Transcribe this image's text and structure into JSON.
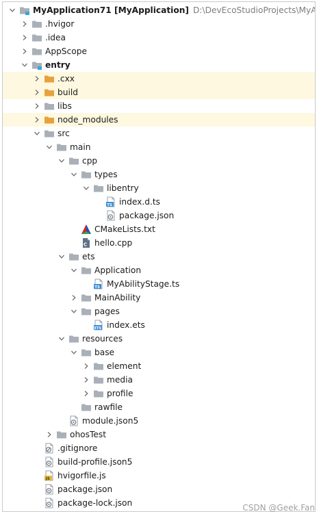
{
  "project": {
    "name": "MyApplication71",
    "module_tag": "[MyApplication]",
    "path": "D:\\DevEcoStudioProjects\\MyApp"
  },
  "tree": [
    {
      "label": "MyApplication71 [MyApplication]",
      "depth": 0,
      "arrow": "down",
      "icon": "module-folder",
      "bold": true,
      "path": "D:\\DevEcoStudioProjects\\MyApp"
    },
    {
      "label": ".hvigor",
      "depth": 1,
      "arrow": "right",
      "icon": "folder"
    },
    {
      "label": ".idea",
      "depth": 1,
      "arrow": "right",
      "icon": "folder"
    },
    {
      "label": "AppScope",
      "depth": 1,
      "arrow": "right",
      "icon": "folder"
    },
    {
      "label": "entry",
      "depth": 1,
      "arrow": "down",
      "icon": "module-folder",
      "bold": true
    },
    {
      "label": ".cxx",
      "depth": 2,
      "arrow": "right",
      "icon": "orange-folder",
      "excluded": true
    },
    {
      "label": "build",
      "depth": 2,
      "arrow": "right",
      "icon": "orange-folder",
      "excluded": true
    },
    {
      "label": "libs",
      "depth": 2,
      "arrow": "right",
      "icon": "folder"
    },
    {
      "label": "node_modules",
      "depth": 2,
      "arrow": "right",
      "icon": "orange-folder",
      "excluded": true
    },
    {
      "label": "src",
      "depth": 2,
      "arrow": "down",
      "icon": "folder"
    },
    {
      "label": "main",
      "depth": 3,
      "arrow": "down",
      "icon": "folder"
    },
    {
      "label": "cpp",
      "depth": 4,
      "arrow": "down",
      "icon": "folder"
    },
    {
      "label": "types",
      "depth": 5,
      "arrow": "down",
      "icon": "folder"
    },
    {
      "label": "libentry",
      "depth": 6,
      "arrow": "down",
      "icon": "folder"
    },
    {
      "label": "index.d.ts",
      "depth": 7,
      "arrow": "none",
      "icon": "ts-file"
    },
    {
      "label": "package.json",
      "depth": 7,
      "arrow": "none",
      "icon": "json-file"
    },
    {
      "label": "CMakeLists.txt",
      "depth": 5,
      "arrow": "none",
      "icon": "cmake-file"
    },
    {
      "label": "hello.cpp",
      "depth": 5,
      "arrow": "none",
      "icon": "cpp-file"
    },
    {
      "label": "ets",
      "depth": 4,
      "arrow": "down",
      "icon": "folder"
    },
    {
      "label": "Application",
      "depth": 5,
      "arrow": "down",
      "icon": "folder"
    },
    {
      "label": "MyAbilityStage.ts",
      "depth": 6,
      "arrow": "none",
      "icon": "ts-file"
    },
    {
      "label": "MainAbility",
      "depth": 5,
      "arrow": "right",
      "icon": "folder"
    },
    {
      "label": "pages",
      "depth": 5,
      "arrow": "down",
      "icon": "folder"
    },
    {
      "label": "index.ets",
      "depth": 6,
      "arrow": "none",
      "icon": "ets-file"
    },
    {
      "label": "resources",
      "depth": 4,
      "arrow": "down",
      "icon": "folder"
    },
    {
      "label": "base",
      "depth": 5,
      "arrow": "down",
      "icon": "folder"
    },
    {
      "label": "element",
      "depth": 6,
      "arrow": "right",
      "icon": "folder"
    },
    {
      "label": "media",
      "depth": 6,
      "arrow": "right",
      "icon": "folder"
    },
    {
      "label": "profile",
      "depth": 6,
      "arrow": "right",
      "icon": "folder"
    },
    {
      "label": "rawfile",
      "depth": 5,
      "arrow": "none",
      "icon": "folder"
    },
    {
      "label": "module.json5",
      "depth": 4,
      "arrow": "none",
      "icon": "json-file"
    },
    {
      "label": "ohosTest",
      "depth": 3,
      "arrow": "right",
      "icon": "folder"
    },
    {
      "label": ".gitignore",
      "depth": 2,
      "arrow": "none",
      "icon": "gitignore-file"
    },
    {
      "label": "build-profile.json5",
      "depth": 2,
      "arrow": "none",
      "icon": "json-file"
    },
    {
      "label": "hvigorfile.js",
      "depth": 2,
      "arrow": "none",
      "icon": "js-file"
    },
    {
      "label": "package.json",
      "depth": 2,
      "arrow": "none",
      "icon": "json-file"
    },
    {
      "label": "package-lock.json",
      "depth": 2,
      "arrow": "none",
      "icon": "json-file"
    }
  ],
  "watermark": "CSDN @Geek.Fan",
  "colors": {
    "folder": "#a9b0b8",
    "orange_folder": "#e8a23d",
    "module_badge": "#35a7d9",
    "excluded_bg": "#fdf8df",
    "ts_badge": "#3a8fd6",
    "js_badge": "#e7b83b",
    "cmake_red": "#d8232a",
    "cmake_green": "#38a849",
    "cmake_blue": "#2c4db1"
  }
}
